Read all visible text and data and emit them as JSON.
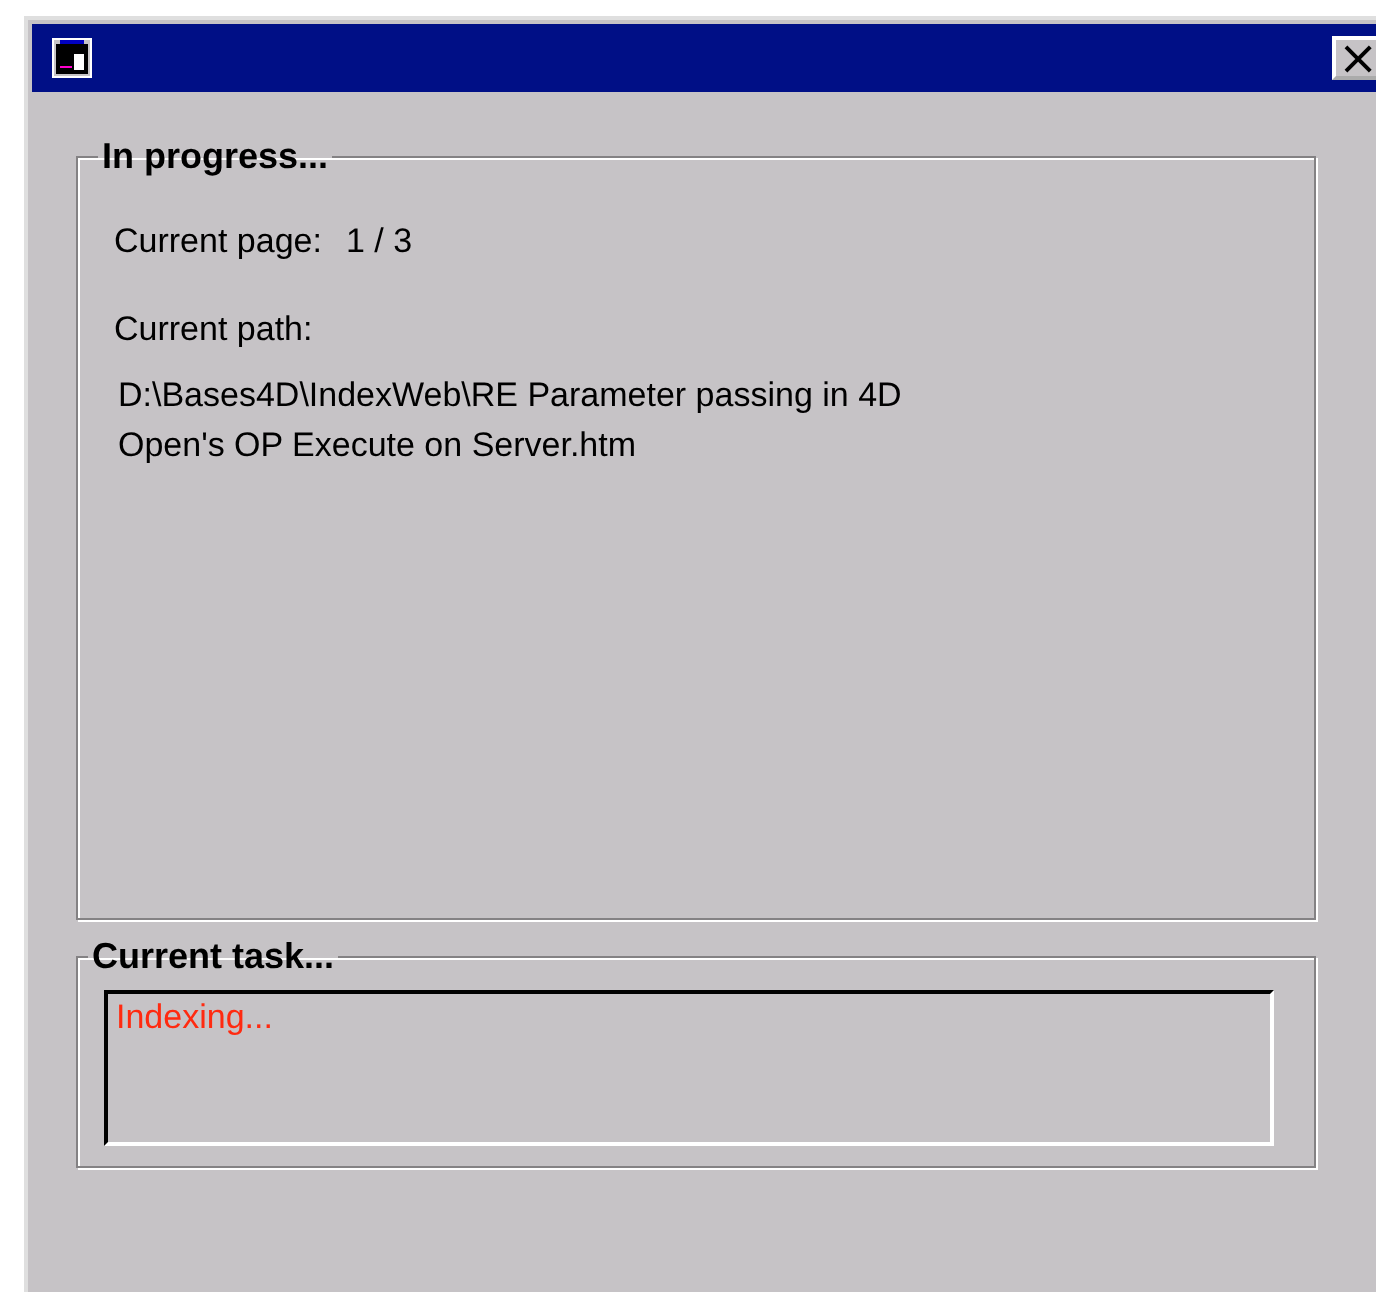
{
  "window": {
    "close_glyph": "×"
  },
  "progress_group": {
    "title": "In progress...",
    "page_label": "Current page:",
    "page_value": "1 / 3",
    "path_label": "Current path:",
    "path_lines": [
      "D:\\Bases4D\\IndexWeb\\RE Parameter passing in 4D",
      "Open's OP Execute on Server.htm"
    ]
  },
  "task_group": {
    "title": "Current task...",
    "status": "Indexing..."
  }
}
